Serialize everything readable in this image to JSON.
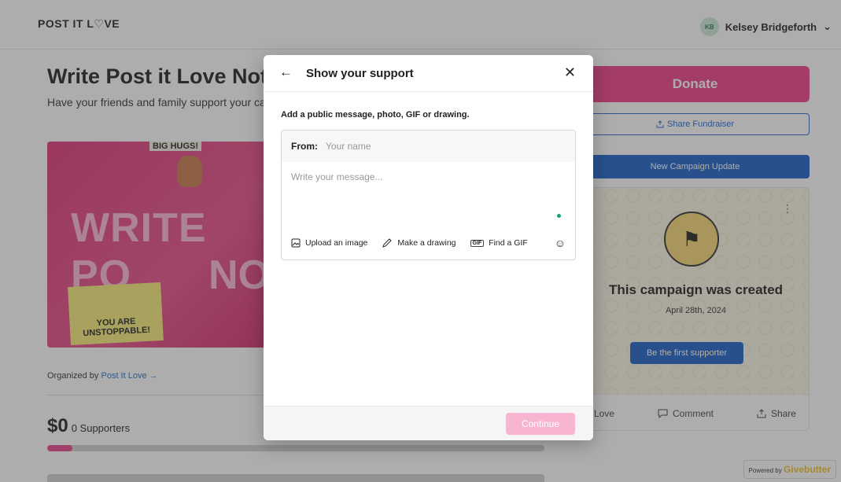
{
  "header": {
    "logo": "POST IT L♡VE",
    "user_initials": "KB",
    "user_name": "Kelsey Bridgeforth",
    "user_chevron": "⌄"
  },
  "campaign": {
    "title": "Write Post it Love Notes",
    "subtitle": "Have your friends and family support your campaign",
    "banner_big1": "WRITE PO",
    "banner_big2": "NO",
    "banner_hugs": "BIG HUGS!",
    "banner_note": "YOU ARE UNSTOPPABLE!",
    "organized_prefix": "Organized by ",
    "organized_link": "Post It Love →",
    "amount": "$0",
    "supporters": "0 Supporters",
    "progress_fraction": 0.05
  },
  "sidebar": {
    "donate": "Donate",
    "share_fundraiser": "Share Fundraiser",
    "new_update": "New Campaign Update",
    "card_title": "This campaign was created",
    "card_date": "April 28th, 2024",
    "first_supporter": "Be the first supporter",
    "love": "Love",
    "comment": "Comment",
    "share": "Share"
  },
  "powered": {
    "prefix": "Powered by",
    "brand": "Givebutter"
  },
  "modal": {
    "title": "Show your support",
    "instruction": "Add a public message, photo, GIF or drawing.",
    "from_label": "From:",
    "from_placeholder": "Your name",
    "message_placeholder": "Write your message...",
    "upload": "Upload an image",
    "drawing": "Make a drawing",
    "gif": "Find a GIF",
    "gif_badge": "GIF",
    "continue": "Continue"
  },
  "colors": {
    "brand_pink": "#ee3d87",
    "brand_blue": "#1a5fc9",
    "continue_disabled": "#f8b5d2"
  },
  "icons": {
    "back": "back-arrow-icon",
    "close": "close-icon",
    "image": "image-icon",
    "pencil": "pencil-icon",
    "gif": "gif-icon",
    "emoji": "emoji-icon",
    "share": "share-icon",
    "comment": "comment-icon",
    "kebab": "kebab-menu-icon"
  }
}
